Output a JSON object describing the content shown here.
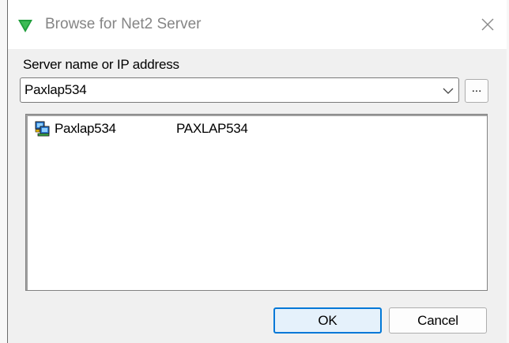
{
  "window": {
    "title": "Browse for Net2 Server",
    "title_icon": "green-triangle-icon",
    "close_icon": "close-icon"
  },
  "server_field": {
    "label": "Server name or IP address",
    "value": "Paxlap534",
    "dropdown_icon": "chevron-down-icon",
    "browse_label": "..."
  },
  "server_list": {
    "rows": [
      {
        "icon": "networked-computer-icon",
        "name": "Paxlap534",
        "host": "PAXLAP534"
      }
    ]
  },
  "buttons": {
    "ok_label": "OK",
    "cancel_label": "Cancel"
  },
  "colors": {
    "accent": "#0078d7",
    "title_icon_green": "#1f9e3b",
    "title_text": "#858585"
  }
}
